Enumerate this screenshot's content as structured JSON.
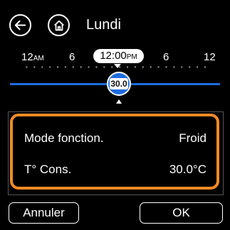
{
  "header": {
    "title": "Lundi",
    "back_icon": "back-arrow-icon",
    "home_icon": "home-icon"
  },
  "timeline": {
    "ticks": [
      {
        "num": "12",
        "suffix": "AM"
      },
      {
        "num": "6",
        "suffix": ""
      },
      {
        "num": "6",
        "suffix": ""
      },
      {
        "num": "12",
        "suffix": ""
      }
    ],
    "current_time": {
      "num": "12:00",
      "suffix": "PM"
    }
  },
  "slider": {
    "value": "30.0",
    "accent": "#1e6ce0"
  },
  "settings": {
    "accent": "#f08a25",
    "rows": [
      {
        "label": "Mode fonction.",
        "value": "Froid"
      },
      {
        "label": "T° Cons.",
        "value": "30.0°C"
      }
    ]
  },
  "footer": {
    "cancel_label": "Annuler",
    "ok_label": "OK"
  }
}
